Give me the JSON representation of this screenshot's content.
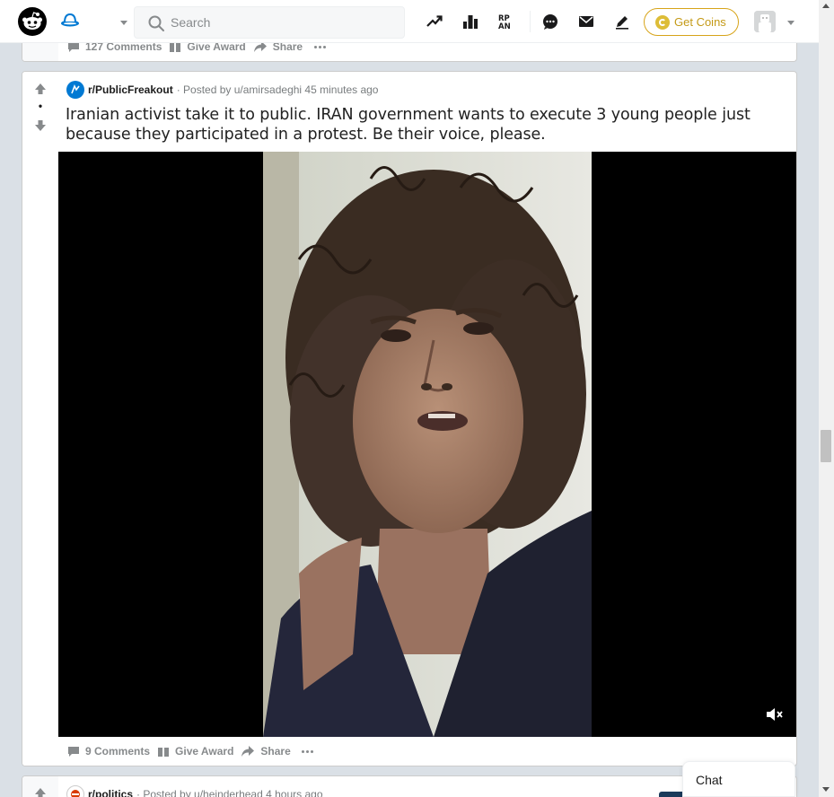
{
  "header": {
    "search_placeholder": "Search",
    "get_coins_label": "Get Coins",
    "icons": [
      "reddit-logo-icon",
      "home-icon",
      "chevron-down-icon",
      "search-icon",
      "trending-icon",
      "leaderboard-icon",
      "rpan-icon",
      "chat-icon",
      "mail-icon",
      "pencil-icon",
      "coin-icon",
      "avatar",
      "chevron-down-icon"
    ]
  },
  "prev_post": {
    "comments": "127 Comments",
    "award": "Give Award",
    "share": "Share"
  },
  "post": {
    "subreddit": "r/PublicFreakout",
    "posted_by": "· Posted by u/amirsadeghi 45 minutes ago",
    "vote_count": "•",
    "title": "Iranian activist take it to public. IRAN government wants to execute 3 young people just because they participated in a protest. Be their voice, please.",
    "comments": "9 Comments",
    "award": "Give Award",
    "share": "Share"
  },
  "next_post": {
    "subreddit": "r/politics",
    "posted_by": "· Posted by u/heinderhead 4 hours ago"
  },
  "chat": {
    "label": "Chat"
  },
  "colors": {
    "background": "#dae0e6",
    "coins_border": "#d7a419",
    "subreddit_icon": "#0079d3",
    "muted_text": "#878a8c"
  }
}
